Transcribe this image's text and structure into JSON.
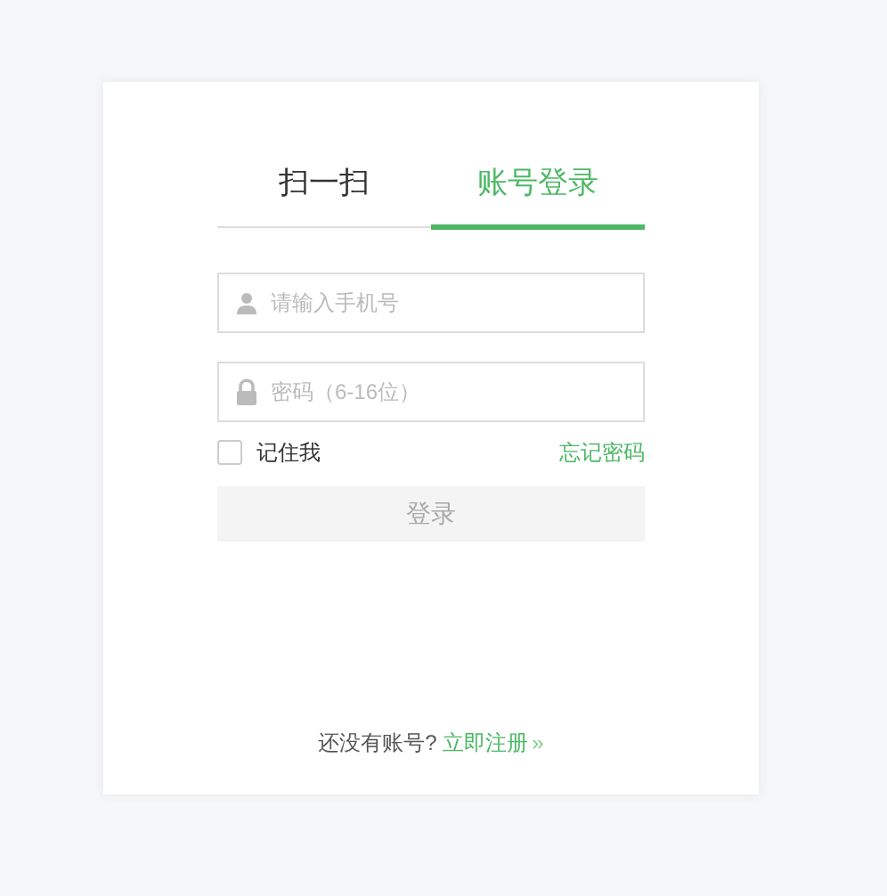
{
  "tabs": [
    {
      "label": "扫一扫",
      "selected": false
    },
    {
      "label": "账号登录",
      "selected": true
    }
  ],
  "phone_field": {
    "placeholder": "请输入手机号"
  },
  "password_field": {
    "placeholder": "密码（6-16位）"
  },
  "remember_me": {
    "label": "记住我",
    "checked": false
  },
  "forgot_password": "忘记密码",
  "login_button": {
    "label": "登录",
    "disabled": true
  },
  "footer": {
    "text": "还没有账号?",
    "link": "立即注册",
    "link_icon": "»"
  }
}
